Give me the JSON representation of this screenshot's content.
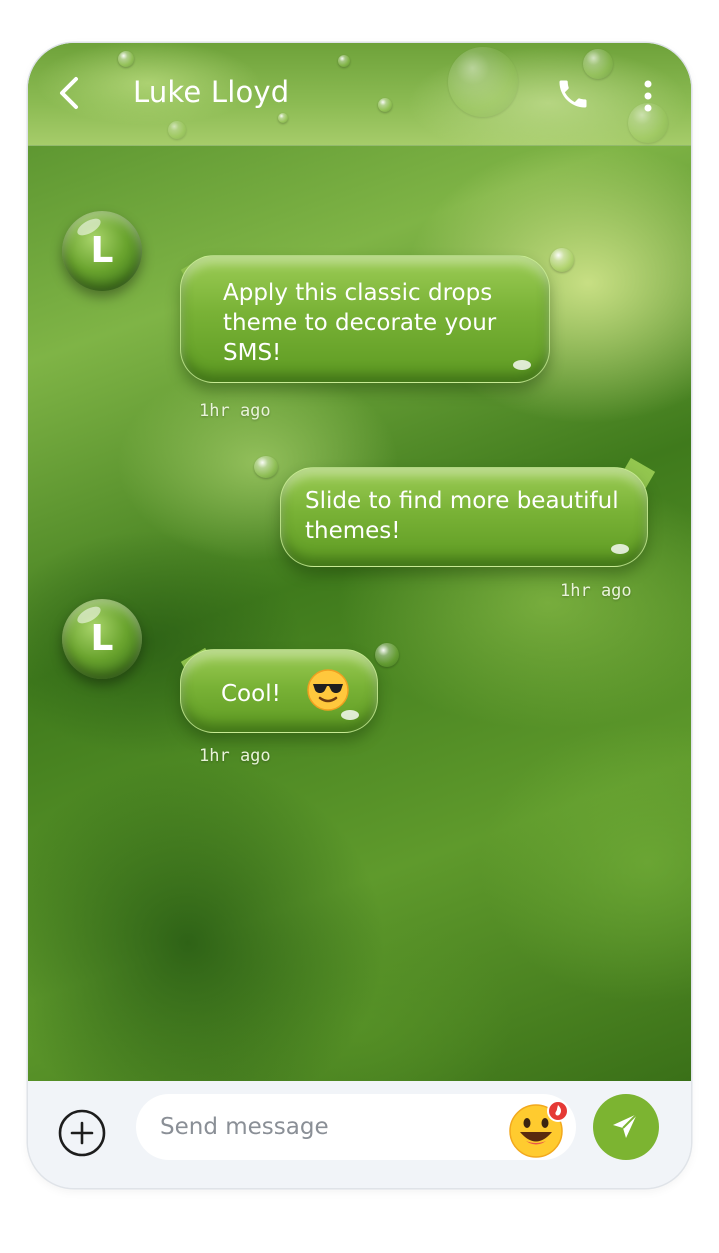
{
  "header": {
    "contact_name": "Luke Lloyd",
    "back_icon": "chevron-left-icon",
    "call_icon": "phone-icon",
    "more_icon": "more-vertical-icon"
  },
  "messages": [
    {
      "direction": "incoming",
      "avatar_letter": "L",
      "text": "Apply this classic drops theme to decorate your SMS!",
      "time": "1hr ago"
    },
    {
      "direction": "outgoing",
      "text": "Slide to find more beautiful themes!",
      "time": "1hr ago"
    },
    {
      "direction": "incoming",
      "avatar_letter": "L",
      "text": "Cool!",
      "emoji": "sunglasses-emoji",
      "time": "1hr ago"
    }
  ],
  "composer": {
    "placeholder": "Send message",
    "add_icon": "plus-circle-icon",
    "emoji_icon": "smiley-emoji-icon",
    "send_icon": "send-icon"
  },
  "colors": {
    "accent_green": "#7cb431",
    "bubble_green": "#79b236",
    "input_bar_bg": "#f1f4f8",
    "notification_badge": "#e53935"
  }
}
